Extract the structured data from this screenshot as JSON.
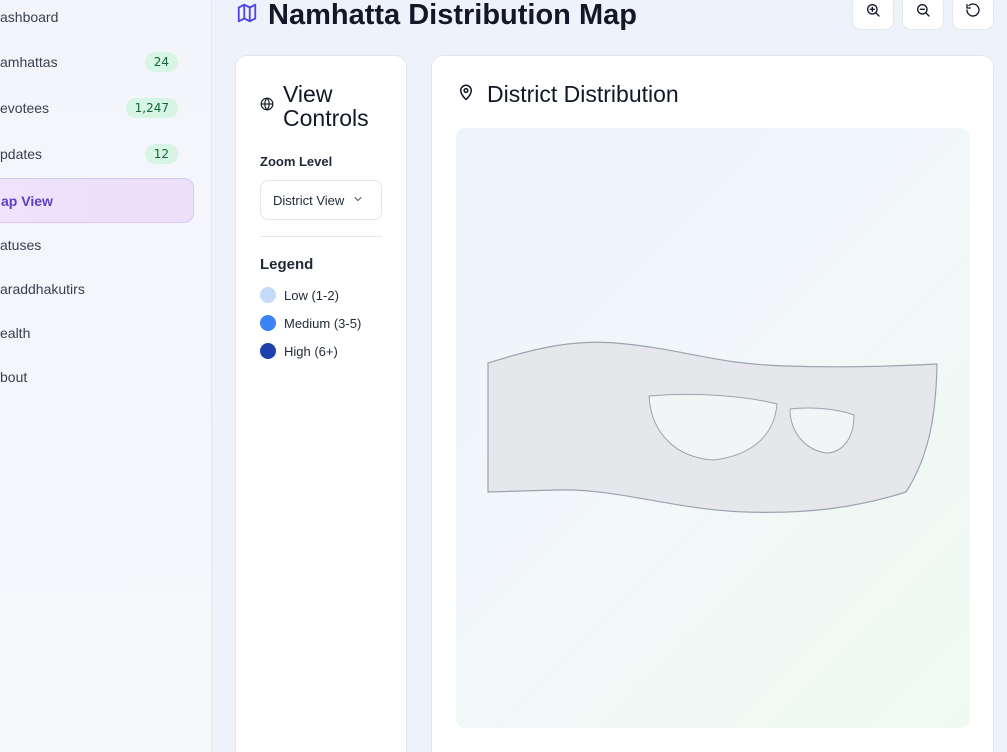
{
  "sidebar": {
    "items": [
      {
        "label": "ashboard",
        "badge": ""
      },
      {
        "label": "amhattas",
        "badge": "24"
      },
      {
        "label": "evotees",
        "badge": "1,247"
      },
      {
        "label": "pdates",
        "badge": "12"
      },
      {
        "label": "ap View",
        "badge": ""
      },
      {
        "label": "atuses",
        "badge": ""
      },
      {
        "label": "araddhakutirs",
        "badge": ""
      },
      {
        "label": "ealth",
        "badge": ""
      },
      {
        "label": "bout",
        "badge": ""
      }
    ]
  },
  "header": {
    "title": "Namhatta Distribution Map",
    "icon": "map-icon",
    "tools": [
      "zoom-in-icon",
      "zoom-out-icon",
      "reset-icon"
    ]
  },
  "controls": {
    "title": "View Controls",
    "zoom_label": "Zoom Level",
    "zoom_value": "District View",
    "legend_title": "Legend",
    "legend": [
      {
        "label": "Low (1-2)",
        "color": "#c5dbf7"
      },
      {
        "label": "Medium (3-5)",
        "color": "#3b82f6"
      },
      {
        "label": "High (6+)",
        "color": "#1e40af"
      }
    ]
  },
  "map": {
    "title": "District Distribution",
    "region_fill": "#e5e7eb",
    "region_stroke": "#9ca3af"
  }
}
